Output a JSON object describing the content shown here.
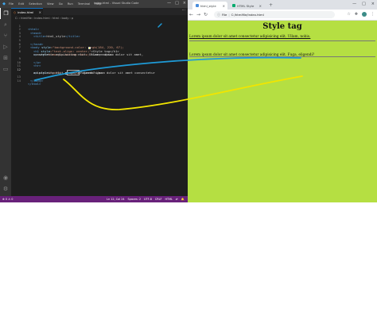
{
  "vscode": {
    "menu": [
      "File",
      "Edit",
      "Selection",
      "View",
      "Go",
      "Run",
      "Terminal",
      "Help"
    ],
    "window_title": "index.html - Visual Studio Code",
    "tab_label": "index.html",
    "tab_close": "×",
    "breadcrumb": [
      "C:",
      "htmlfile",
      "index.html",
      "html",
      "body",
      "p"
    ],
    "lines": [
      {
        "n": "1"
      },
      {
        "n": "2"
      },
      {
        "n": "3"
      },
      {
        "n": "4"
      },
      {
        "n": "5"
      },
      {
        "n": "6"
      },
      {
        "n": "7"
      },
      {
        "n": "8"
      },
      {
        "n": "9"
      },
      {
        "n": "10"
      },
      {
        "n": "11"
      },
      {
        "n": "12"
      },
      {
        "n": "13"
      },
      {
        "n": "14"
      },
      {
        "n": "15"
      }
    ],
    "code": {
      "l1": "<html>",
      "l2": "<head>",
      "l3a": "<title>",
      "l3b": "html_style",
      "l3c": "</title>",
      "l5": "</head>",
      "l6a": "<body ",
      "l6b": "style",
      "l6c": "=\"background-color: ",
      "l6d": "rgb(184, 220, 67);",
      "l7a": "<h1 ",
      "l7b": "style",
      "l7c": "=\"text-align: center;\"",
      "l7d": ">Style tag</h1>",
      "l8a": "<p ",
      "l8b": "style",
      "l8c": "=\"margin-bottom: auto;\"",
      "l8d": ">Lorem ipsum dolor sit amet,",
      "l8e": "consectetur adipisicing elit. Ullam, nobis.",
      "l9a": "</p>",
      "l10": "<hr>",
      "l12a": "<p ",
      "l12b": "style",
      "l12c": "=\"color: ",
      "l12d": "yellow",
      "l12e": ";\">Lorem ipsum dolor sit amet consectetur",
      "l12f": "adipisicing elit. Fuga, eligendi?</p>",
      "l13": "</body>",
      "l14": "</html>"
    },
    "status": {
      "left": [
        "⊗ 0 ⚠ 0"
      ],
      "right": [
        "Ln 12, Col 24",
        "Spaces: 2",
        "UTF-8",
        "CRLF",
        "HTML",
        "⇄",
        "🔔"
      ]
    }
  },
  "browser": {
    "tabs": [
      {
        "label": "html_style",
        "close": "×"
      },
      {
        "label": "HTML Style",
        "close": "×"
      }
    ],
    "new_tab": "+",
    "window_controls": [
      "—",
      "□",
      "×"
    ],
    "url_prefix": "File",
    "url": "C:/htmlfile/index.html",
    "page": {
      "heading": "Style tag",
      "para1": "Lorem ipsum dolor sit amet consectetur adipisicing elit. Ullam, nobis.",
      "para2": "Lorem ipsum dolor sit amet consectetur adipisicing elit. Fuga, eligendi?"
    }
  },
  "colors": {
    "page_background": "#b5df42",
    "annotation_blue": "#1e9ad6",
    "annotation_yellow": "#f2e500"
  }
}
